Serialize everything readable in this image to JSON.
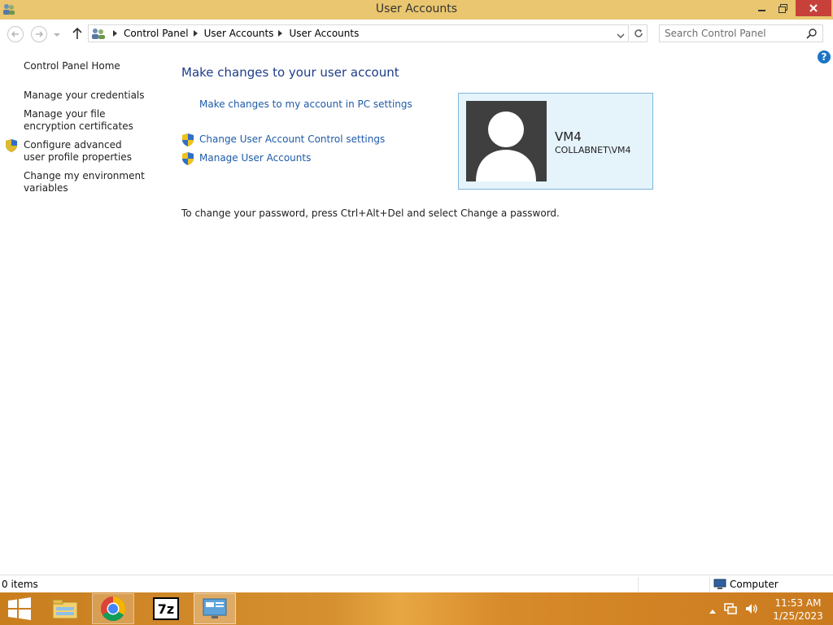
{
  "window": {
    "title": "User Accounts"
  },
  "nav": {
    "breadcrumbs": [
      "Control Panel",
      "User Accounts",
      "User Accounts"
    ],
    "search_placeholder": "Search Control Panel"
  },
  "leftnav": {
    "items": [
      "Control Panel Home",
      "Manage your credentials",
      "Manage your file encryption certificates",
      "Configure advanced user profile properties",
      "Change my environment variables"
    ]
  },
  "main": {
    "heading": "Make changes to your user account",
    "links": {
      "pc_settings": "Make changes to my account in PC settings",
      "uac": "Change User Account Control settings",
      "manage": "Manage User Accounts"
    },
    "password_note": "To change your password, press Ctrl+Alt+Del and select Change a password."
  },
  "user": {
    "name": "VM4",
    "domain": "COLLABNET\\VM4"
  },
  "statusbar": {
    "items": "0 items",
    "location": "Computer"
  },
  "taskbar": {
    "time": "11:53 AM",
    "date": "1/25/2023",
    "sevenzip_label": "7z"
  },
  "colors": {
    "titlebar": "#e9c66f",
    "close": "#c7413a",
    "link": "#1e5ba8",
    "heading": "#1e3c8c",
    "card_bg": "#e5f3fb",
    "card_border": "#7fb7dc",
    "taskbar": "#d69030"
  },
  "icons": [
    "control-panel-icon",
    "back-arrow-icon",
    "forward-arrow-icon",
    "up-arrow-icon",
    "refresh-icon",
    "search-icon",
    "help-icon",
    "shield-icon",
    "user-avatar-icon",
    "computer-icon",
    "windows-start-icon",
    "file-explorer-icon",
    "chrome-icon",
    "7zip-icon",
    "speaker-icon",
    "network-icon"
  ]
}
